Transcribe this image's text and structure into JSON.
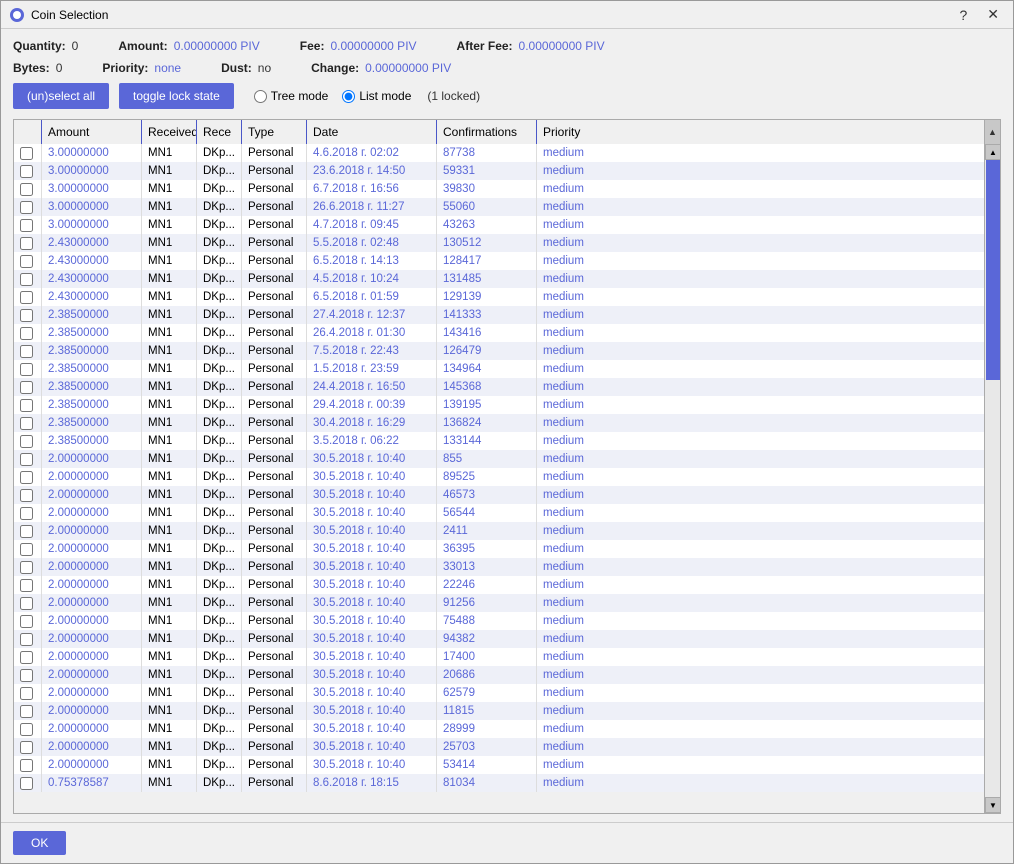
{
  "window": {
    "title": "Coin Selection",
    "close_btn": "✕",
    "help_btn": "?"
  },
  "stats": {
    "quantity_label": "Quantity:",
    "quantity_value": "0",
    "bytes_label": "Bytes:",
    "bytes_value": "0",
    "amount_label": "Amount:",
    "amount_value": "0.00000000 PIV",
    "priority_label": "Priority:",
    "priority_value": "none",
    "fee_label": "Fee:",
    "fee_value": "0.00000000 PIV",
    "dust_label": "Dust:",
    "dust_value": "no",
    "after_fee_label": "After Fee:",
    "after_fee_value": "0.00000000 PIV",
    "change_label": "Change:",
    "change_value": "0.00000000 PIV"
  },
  "toolbar": {
    "unselect_all": "(un)select all",
    "toggle_lock": "toggle lock state",
    "tree_mode": "Tree mode",
    "list_mode": "List mode",
    "locked_info": "(1 locked)"
  },
  "table": {
    "headers": [
      "",
      "Amount",
      "Received wi",
      "Rece",
      "Type",
      "Date",
      "Confirmations",
      "Priority"
    ],
    "rows": [
      [
        "",
        "3.00000000",
        "MN1",
        "DKp...",
        "Personal",
        "4.6.2018 г. 02:02",
        "87738",
        "medium"
      ],
      [
        "",
        "3.00000000",
        "MN1",
        "DKp...",
        "Personal",
        "23.6.2018 г. 14:50",
        "59331",
        "medium"
      ],
      [
        "",
        "3.00000000",
        "MN1",
        "DKp...",
        "Personal",
        "6.7.2018 г. 16:56",
        "39830",
        "medium"
      ],
      [
        "",
        "3.00000000",
        "MN1",
        "DKp...",
        "Personal",
        "26.6.2018 г. 11:27",
        "55060",
        "medium"
      ],
      [
        "",
        "3.00000000",
        "MN1",
        "DKp...",
        "Personal",
        "4.7.2018 г. 09:45",
        "43263",
        "medium"
      ],
      [
        "",
        "2.43000000",
        "MN1",
        "DKp...",
        "Personal",
        "5.5.2018 г. 02:48",
        "130512",
        "medium"
      ],
      [
        "",
        "2.43000000",
        "MN1",
        "DKp...",
        "Personal",
        "6.5.2018 г. 14:13",
        "128417",
        "medium"
      ],
      [
        "",
        "2.43000000",
        "MN1",
        "DKp...",
        "Personal",
        "4.5.2018 г. 10:24",
        "131485",
        "medium"
      ],
      [
        "",
        "2.43000000",
        "MN1",
        "DKp...",
        "Personal",
        "6.5.2018 г. 01:59",
        "129139",
        "medium"
      ],
      [
        "",
        "2.38500000",
        "MN1",
        "DKp...",
        "Personal",
        "27.4.2018 г. 12:37",
        "141333",
        "medium"
      ],
      [
        "",
        "2.38500000",
        "MN1",
        "DKp...",
        "Personal",
        "26.4.2018 г. 01:30",
        "143416",
        "medium"
      ],
      [
        "",
        "2.38500000",
        "MN1",
        "DKp...",
        "Personal",
        "7.5.2018 г. 22:43",
        "126479",
        "medium"
      ],
      [
        "",
        "2.38500000",
        "MN1",
        "DKp...",
        "Personal",
        "1.5.2018 г. 23:59",
        "134964",
        "medium"
      ],
      [
        "",
        "2.38500000",
        "MN1",
        "DKp...",
        "Personal",
        "24.4.2018 г. 16:50",
        "145368",
        "medium"
      ],
      [
        "",
        "2.38500000",
        "MN1",
        "DKp...",
        "Personal",
        "29.4.2018 г. 00:39",
        "139195",
        "medium"
      ],
      [
        "",
        "2.38500000",
        "MN1",
        "DKp...",
        "Personal",
        "30.4.2018 г. 16:29",
        "136824",
        "medium"
      ],
      [
        "",
        "2.38500000",
        "MN1",
        "DKp...",
        "Personal",
        "3.5.2018 г. 06:22",
        "133144",
        "medium"
      ],
      [
        "",
        "2.00000000",
        "MN1",
        "DKp...",
        "Personal",
        "30.5.2018 г. 10:40",
        "855",
        "medium"
      ],
      [
        "",
        "2.00000000",
        "MN1",
        "DKp...",
        "Personal",
        "30.5.2018 г. 10:40",
        "89525",
        "medium"
      ],
      [
        "",
        "2.00000000",
        "MN1",
        "DKp...",
        "Personal",
        "30.5.2018 г. 10:40",
        "46573",
        "medium"
      ],
      [
        "",
        "2.00000000",
        "MN1",
        "DKp...",
        "Personal",
        "30.5.2018 г. 10:40",
        "56544",
        "medium"
      ],
      [
        "",
        "2.00000000",
        "MN1",
        "DKp...",
        "Personal",
        "30.5.2018 г. 10:40",
        "2411",
        "medium"
      ],
      [
        "",
        "2.00000000",
        "MN1",
        "DKp...",
        "Personal",
        "30.5.2018 г. 10:40",
        "36395",
        "medium"
      ],
      [
        "",
        "2.00000000",
        "MN1",
        "DKp...",
        "Personal",
        "30.5.2018 г. 10:40",
        "33013",
        "medium"
      ],
      [
        "",
        "2.00000000",
        "MN1",
        "DKp...",
        "Personal",
        "30.5.2018 г. 10:40",
        "22246",
        "medium"
      ],
      [
        "",
        "2.00000000",
        "MN1",
        "DKp...",
        "Personal",
        "30.5.2018 г. 10:40",
        "91256",
        "medium"
      ],
      [
        "",
        "2.00000000",
        "MN1",
        "DKp...",
        "Personal",
        "30.5.2018 г. 10:40",
        "75488",
        "medium"
      ],
      [
        "",
        "2.00000000",
        "MN1",
        "DKp...",
        "Personal",
        "30.5.2018 г. 10:40",
        "94382",
        "medium"
      ],
      [
        "",
        "2.00000000",
        "MN1",
        "DKp...",
        "Personal",
        "30.5.2018 г. 10:40",
        "17400",
        "medium"
      ],
      [
        "",
        "2.00000000",
        "MN1",
        "DKp...",
        "Personal",
        "30.5.2018 г. 10:40",
        "20686",
        "medium"
      ],
      [
        "",
        "2.00000000",
        "MN1",
        "DKp...",
        "Personal",
        "30.5.2018 г. 10:40",
        "62579",
        "medium"
      ],
      [
        "",
        "2.00000000",
        "MN1",
        "DKp...",
        "Personal",
        "30.5.2018 г. 10:40",
        "11815",
        "medium"
      ],
      [
        "",
        "2.00000000",
        "MN1",
        "DKp...",
        "Personal",
        "30.5.2018 г. 10:40",
        "28999",
        "medium"
      ],
      [
        "",
        "2.00000000",
        "MN1",
        "DKp...",
        "Personal",
        "30.5.2018 г. 10:40",
        "25703",
        "medium"
      ],
      [
        "",
        "2.00000000",
        "MN1",
        "DKp...",
        "Personal",
        "30.5.2018 г. 10:40",
        "53414",
        "medium"
      ],
      [
        "",
        "0.75378587",
        "MN1",
        "DKp...",
        "Personal",
        "8.6.2018 г. 18:15",
        "81034",
        "medium"
      ]
    ]
  },
  "bottom": {
    "ok_label": "OK"
  }
}
